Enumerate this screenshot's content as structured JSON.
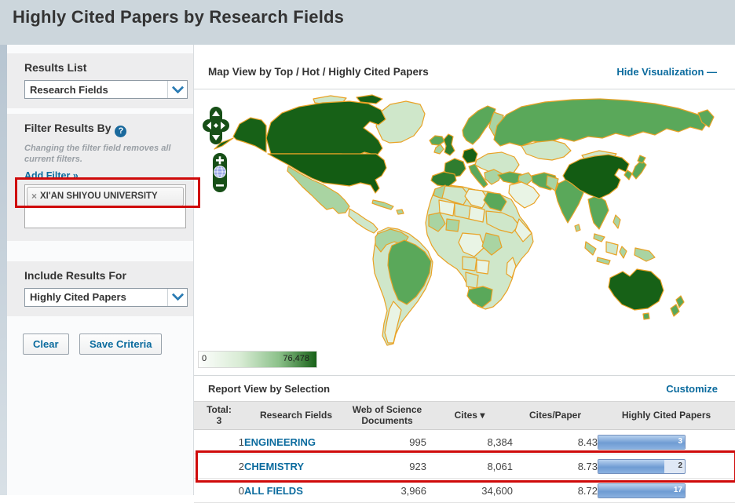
{
  "page": {
    "title": "Highly Cited Papers by Research Fields"
  },
  "sidebar": {
    "results_list": {
      "label": "Results List",
      "selected": "Research Fields"
    },
    "filter": {
      "heading": "Filter Results By",
      "note": "Changing the filter field removes all current filters.",
      "add_filter": "Add Filter »",
      "tag_remove": "×",
      "tag_label": "XI'AN SHIYOU UNIVERSITY"
    },
    "include": {
      "label": "Include Results For",
      "selected": "Highly Cited Papers"
    },
    "buttons": {
      "clear": "Clear",
      "save": "Save Criteria"
    }
  },
  "map_panel": {
    "title": "Map View by Top / Hot / Highly Cited Papers",
    "hide_link": "Hide Visualization —",
    "legend": {
      "min": "0",
      "max": "76,478"
    },
    "controls": {
      "pan": "pan-icon",
      "zoom_in": "plus-icon",
      "globe": "globe-icon",
      "zoom_out": "minus-icon"
    }
  },
  "report": {
    "title": "Report View by Selection",
    "customize": "Customize",
    "table": {
      "total_label": "Total:",
      "total_value": "3",
      "headers": {
        "field": "Research Fields",
        "docs": "Web of Science Documents",
        "cites": "Cites",
        "sort_arrow": "▾",
        "cpp": "Cites/Paper",
        "hcp": "Highly Cited Papers"
      },
      "rows": [
        {
          "rank": "1",
          "field": "ENGINEERING",
          "docs": "995",
          "cites": "8,384",
          "cpp": "8.43",
          "hcp": "3",
          "bar_fill": 100
        },
        {
          "rank": "2",
          "field": "CHEMISTRY",
          "docs": "923",
          "cites": "8,061",
          "cpp": "8.73",
          "hcp": "2",
          "bar_fill": 76
        },
        {
          "rank": "0",
          "field": "ALL FIELDS",
          "docs": "3,966",
          "cites": "34,600",
          "cpp": "8.72",
          "hcp": "17",
          "bar_fill": 100
        }
      ]
    }
  },
  "colors": {
    "header_strip": "#ccd6dc",
    "link_blue": "#0b6b9e",
    "annotation_red": "#cf0a0a",
    "map_border_orange": "#e9a225",
    "map_dark_green": "#176117",
    "bar_blue": "#6f9cd3"
  }
}
